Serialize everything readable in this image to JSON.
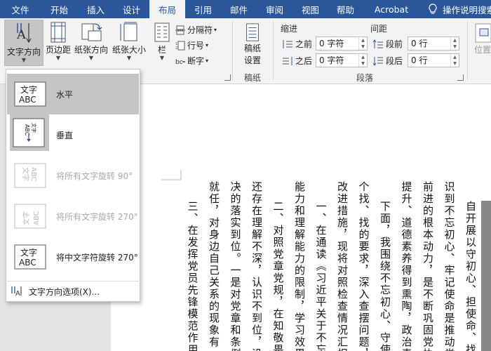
{
  "tabs": [
    {
      "label": "文件",
      "active": false
    },
    {
      "label": "开始",
      "active": false
    },
    {
      "label": "插入",
      "active": false
    },
    {
      "label": "设计",
      "active": false
    },
    {
      "label": "布局",
      "active": true
    },
    {
      "label": "引用",
      "active": false
    },
    {
      "label": "邮件",
      "active": false
    },
    {
      "label": "审阅",
      "active": false
    },
    {
      "label": "视图",
      "active": false
    },
    {
      "label": "帮助",
      "active": false
    },
    {
      "label": "Acrobat",
      "active": false
    }
  ],
  "tell_me": "操作说明搜索",
  "ribbon": {
    "text_direction": "文字方向",
    "margins": "页边距",
    "orientation": "纸张方向",
    "size": "纸张大小",
    "columns": "栏",
    "breaks": "分隔符",
    "line_numbers": "行号",
    "hyphenation": "断字",
    "draft_settings_1": "稿纸",
    "draft_settings_2": "设置",
    "draft_group": "稿纸",
    "indent_title": "缩进",
    "spacing_title": "间距",
    "indent_left_label": "之前",
    "indent_left_value": "0 字符",
    "indent_right_label": "之后",
    "indent_right_value": "0 字符",
    "space_before_label": "段前",
    "space_before_value": "0 行",
    "space_after_label": "段后",
    "space_after_value": "0 行",
    "paragraph_group": "段落",
    "position": "位置"
  },
  "menu": {
    "items": [
      {
        "icon_text": "文字\nABC",
        "label": "水平",
        "selected": true,
        "disabled": false
      },
      {
        "icon_text": "",
        "label": "垂直",
        "selected": false,
        "disabled": false
      },
      {
        "icon_text": "",
        "label": "将所有文字旋转 90°",
        "selected": false,
        "disabled": true
      },
      {
        "icon_text": "",
        "label": "将所有文字旋转 270°",
        "selected": false,
        "disabled": true
      },
      {
        "icon_text": "",
        "label": "将中文字符旋转 270°",
        "selected": false,
        "disabled": false
      }
    ],
    "footer": "文字方向选项(X)..."
  },
  "icon_text": {
    "abc": "ABC",
    "wenzi": "文字"
  },
  "document": {
    "columns": [
      "自开展以守初心、担使命、找差",
      "识到不忘初心、牢记使命是推动党",
      "前进的根本动力，是不断巩固党执政",
      "提升、道德素养得到熏陶，政治素养",
      "下面，我围绕不忘初心、守使命",
      "个找、找的要求，深入查摆问题，深刻",
      "改进措施，现将对照检查情况汇报如下",
      "一、在通读《习近平关于不忘初",
      "能力和理解能力的限制，学习效果不强",
      "二、对照党章党规，在知敬畏、存",
      "还存在理解不深，认识不到位，没有从全",
      "决的落实到位。一是对党章和条例、准",
      "就任，对身边自己关系的现象有一事",
      "三、在发挥党员先锋模范作用方面"
    ]
  }
}
